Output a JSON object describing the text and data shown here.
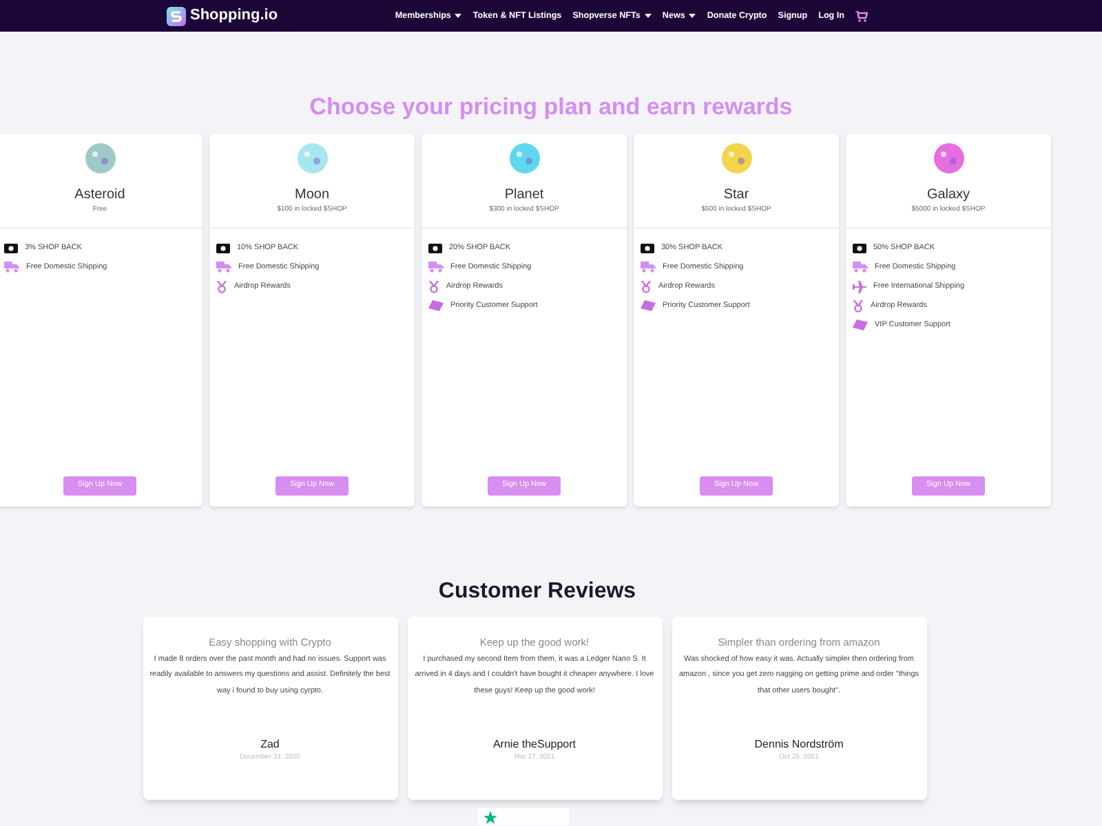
{
  "nav": {
    "logo": "Shopping.io",
    "items": [
      {
        "label": "Memberships",
        "dropdown": true
      },
      {
        "label": "Token & NFT Listings",
        "dropdown": false
      },
      {
        "label": "Shopverse NFTs",
        "dropdown": true
      },
      {
        "label": "News",
        "dropdown": true
      },
      {
        "label": "Donate Crypto",
        "dropdown": false
      },
      {
        "label": "Signup",
        "dropdown": false
      },
      {
        "label": "Log In",
        "dropdown": false
      }
    ]
  },
  "pricing": {
    "heading": "Choose your pricing plan and earn rewards",
    "plans": [
      {
        "name": "Asteroid",
        "price": "Free",
        "color": "#9fc9c9",
        "features": [
          {
            "kind": "cash",
            "text": "3% SHOP BACK"
          },
          {
            "kind": "shipping",
            "text": "Free Domestic Shipping"
          }
        ],
        "button": "Sign Up Now"
      },
      {
        "name": "Moon",
        "price": "$100 in locked $SHOP",
        "color": "#a8e6ef",
        "features": [
          {
            "kind": "cash",
            "text": "10% SHOP BACK"
          },
          {
            "kind": "shipping",
            "text": "Free Domestic Shipping"
          },
          {
            "kind": "airdrop",
            "text": "Airdrop Rewards"
          }
        ],
        "button": "Sign Up Now"
      },
      {
        "name": "Planet",
        "price": "$300 in locked $SHOP",
        "color": "#5fd8ee",
        "features": [
          {
            "kind": "cash",
            "text": "20% SHOP BACK"
          },
          {
            "kind": "shipping",
            "text": "Free Domestic Shipping"
          },
          {
            "kind": "airdrop",
            "text": "Airdrop Rewards"
          },
          {
            "kind": "support",
            "text": "Priority Customer Support"
          }
        ],
        "button": "Sign Up Now"
      },
      {
        "name": "Star",
        "price": "$500 in locked $SHOP",
        "color": "#f3d44a",
        "features": [
          {
            "kind": "cash",
            "text": "30% SHOP BACK"
          },
          {
            "kind": "shipping",
            "text": "Free Domestic Shipping"
          },
          {
            "kind": "airdrop",
            "text": "Airdrop Rewards"
          },
          {
            "kind": "support",
            "text": "Priority Customer Support"
          }
        ],
        "button": "Sign Up Now"
      },
      {
        "name": "Galaxy",
        "price": "$5000 in locked $SHOP",
        "color": "#e66ee0",
        "features": [
          {
            "kind": "cash",
            "text": "50% SHOP BACK"
          },
          {
            "kind": "shipping",
            "text": "Free Domestic Shipping"
          },
          {
            "kind": "international",
            "text": "Free International Shipping"
          },
          {
            "kind": "airdrop",
            "text": "Airdrop Rewards"
          },
          {
            "kind": "support",
            "text": "VIP Customer Support"
          }
        ],
        "button": "Sign Up Now"
      }
    ]
  },
  "reviews": {
    "heading": "Customer Reviews",
    "items": [
      {
        "title": "Easy shopping with Crypto",
        "text": "I made 8 orders over the past month and had no issues. Support was readily available to answers my questions and assist. Definitely the best way i found to buy using cyrpto.",
        "author": "Zad",
        "date": "December 31, 2020"
      },
      {
        "title": "Keep up the good work!",
        "text": "I purchased my second Item from them, it was a Ledger Nano S. It arrived in 4 days and I couldn't have bought it cheaper anywhere. I love these guys! Keep up the good work!",
        "author": "Arnie theSupport",
        "date": "Mar 27, 2021"
      },
      {
        "title": "Simpler than ordering from amazon",
        "text": "Was shocked of how easy it was. Actually simpler then ordering from amazon , since you get zero nagging on getting prime and order \"things that other users bought\".",
        "author": "Dennis Nordström",
        "date": "Oct 26, 2021"
      }
    ]
  }
}
